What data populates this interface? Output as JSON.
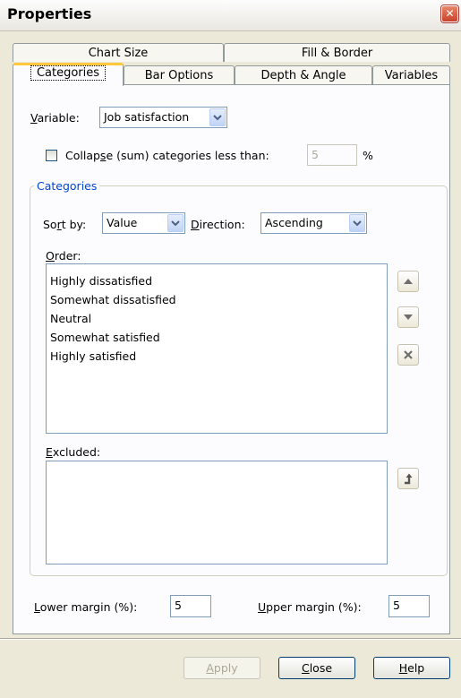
{
  "window": {
    "title": "Properties",
    "close_glyph": "✕"
  },
  "tabs_back": [
    "Chart Size",
    "Fill & Border"
  ],
  "tabs_front": [
    "Categories",
    "Bar Options",
    "Depth & Angle",
    "Variables"
  ],
  "variable": {
    "label_u": "V",
    "label_rest": "ariable:",
    "value": "Job satisfaction"
  },
  "collapse": {
    "label_pre": "Collap",
    "label_u": "s",
    "label_post": "e (sum) categories less than:",
    "value": "5",
    "unit": "%",
    "checked": false
  },
  "categories_group": {
    "title": "Categories",
    "sort_by": {
      "label_pre": "So",
      "label_u": "r",
      "label_post": "t by:",
      "value": "Value"
    },
    "direction": {
      "label_u": "D",
      "label_rest": "irection:",
      "value": "Ascending"
    },
    "order": {
      "label_u": "O",
      "label_rest": "rder:",
      "items": [
        "Highly dissatisfied",
        "Somewhat dissatisfied",
        "Neutral",
        "Somewhat satisfied",
        "Highly satisfied"
      ]
    },
    "excluded": {
      "label_u": "E",
      "label_rest": "xcluded:",
      "items": []
    }
  },
  "margins": {
    "lower": {
      "label_u": "L",
      "label_rest": "ower margin (%):",
      "value": "5"
    },
    "upper": {
      "label_u": "U",
      "label_rest": "pper margin (%):",
      "value": "5"
    }
  },
  "buttons": {
    "apply": {
      "u": "A",
      "rest": "pply",
      "enabled": false
    },
    "close": {
      "u": "C",
      "rest": "lose"
    },
    "help": {
      "u": "H",
      "rest": "elp"
    }
  },
  "icons": {
    "up": "arrow-up-icon",
    "down": "arrow-down-icon",
    "remove": "x-icon",
    "restore": "restore-arrow-icon",
    "dropdown": "chevron-down-icon"
  }
}
